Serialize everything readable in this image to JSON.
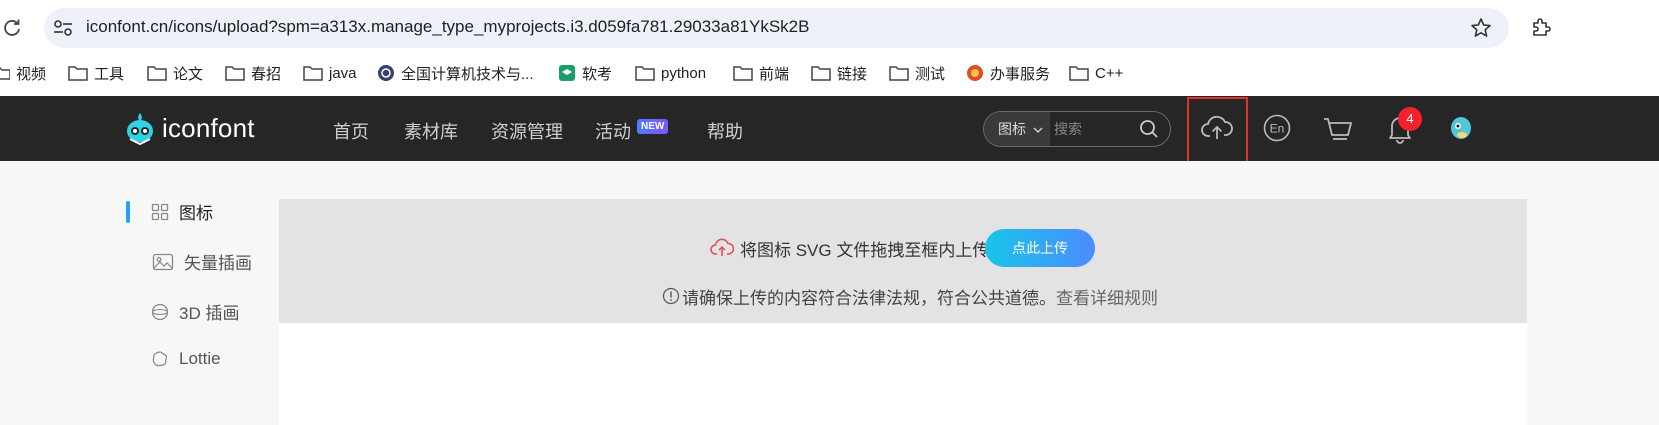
{
  "browser": {
    "url": "iconfont.cn/icons/upload?spm=a313x.manage_type_myprojects.i3.d059fa781.29033a81YkSk2B",
    "bookmarks": [
      {
        "label": "视频",
        "icon": "folder-icon"
      },
      {
        "label": "工具",
        "icon": "folder-icon"
      },
      {
        "label": "论文",
        "icon": "folder-icon"
      },
      {
        "label": "春招",
        "icon": "folder-icon"
      },
      {
        "label": "java",
        "icon": "folder-icon"
      },
      {
        "label": "全国计算机技术与...",
        "icon": "site-logo-icon"
      },
      {
        "label": "软考",
        "icon": "site-logo-icon"
      },
      {
        "label": "python",
        "icon": "folder-icon"
      },
      {
        "label": "前端",
        "icon": "folder-icon"
      },
      {
        "label": "链接",
        "icon": "folder-icon"
      },
      {
        "label": "测试",
        "icon": "folder-icon"
      },
      {
        "label": "办事服务",
        "icon": "site-logo-icon"
      },
      {
        "label": "C++",
        "icon": "folder-icon"
      }
    ]
  },
  "header": {
    "logo_text": "iconfont",
    "nav": [
      "首页",
      "素材库",
      "资源管理",
      "活动",
      "帮助"
    ],
    "new_badge": "NEW",
    "search_type": "图标",
    "search_placeholder": "搜索",
    "notification_count": "4",
    "colors": {
      "background": "#262626",
      "badge": "#f5222d",
      "highlight_box": "#e0312a"
    }
  },
  "sidebar": {
    "items": [
      {
        "label": "图标",
        "icon": "grid-icon",
        "active": true
      },
      {
        "label": "矢量插画",
        "icon": "image-icon"
      },
      {
        "label": "3D 插画",
        "icon": "sphere-icon"
      },
      {
        "label": "Lottie",
        "icon": "lottie-icon"
      }
    ]
  },
  "upload": {
    "drop_text": "将图标 SVG 文件拖拽至框内上传",
    "button_label": "点此上传",
    "rule_text": "请确保上传的内容符合法律法规，符合公共道德。",
    "rule_link": "查看详细规则"
  }
}
